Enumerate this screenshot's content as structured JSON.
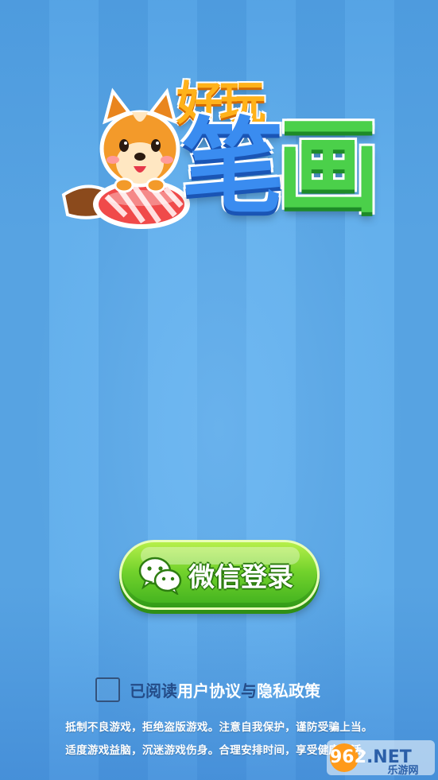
{
  "logo": {
    "line1": "好玩",
    "line2_a": "笔",
    "line2_b": "画",
    "mascot": "dog-mascot-on-candy"
  },
  "login": {
    "label": "微信登录",
    "icon": "wechat-icon"
  },
  "agreement": {
    "read": "已阅读",
    "user_agreement": "用户协议",
    "and": "与",
    "privacy_policy": "隐私政策",
    "checked": false
  },
  "notice": {
    "line1": "抵制不良游戏，拒绝盗版游戏。注意自我保护，谨防受骗上当。",
    "line2": "适度游戏益脑，沉迷游戏伤身。合理安排时间，享受健康生活。"
  },
  "watermark": {
    "brand": "962.NET",
    "sub": "乐游网"
  },
  "colors": {
    "background": "#5aa8e6",
    "button_green": "#72d22c",
    "text_dark_blue": "#244c88"
  }
}
